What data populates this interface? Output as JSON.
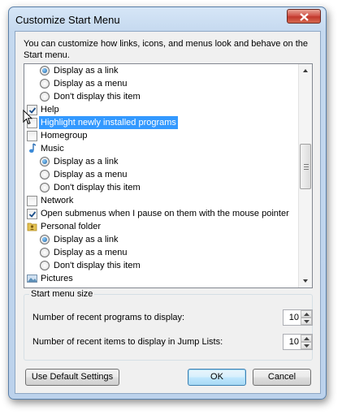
{
  "window": {
    "title": "Customize Start Menu"
  },
  "description": "You can customize how links, icons, and menus look and behave on the Start menu.",
  "list": {
    "rows": [
      {
        "kind": "radio",
        "label": "Display as a link",
        "selected": true
      },
      {
        "kind": "radio",
        "label": "Display as a menu",
        "selected": false
      },
      {
        "kind": "radio",
        "label": "Don't display this item",
        "selected": false
      },
      {
        "kind": "checkbox",
        "label": "Help",
        "checked": true
      },
      {
        "kind": "checkbox",
        "label": "Highlight newly installed programs",
        "checked": false,
        "highlighted": true
      },
      {
        "kind": "checkbox",
        "label": "Homegroup",
        "checked": false
      },
      {
        "kind": "header",
        "label": "Music",
        "icon": "music-note-icon"
      },
      {
        "kind": "radio",
        "label": "Display as a link",
        "selected": true
      },
      {
        "kind": "radio",
        "label": "Display as a menu",
        "selected": false
      },
      {
        "kind": "radio",
        "label": "Don't display this item",
        "selected": false
      },
      {
        "kind": "checkbox",
        "label": "Network",
        "checked": false
      },
      {
        "kind": "checkbox",
        "label": "Open submenus when I pause on them with the mouse pointer",
        "checked": true
      },
      {
        "kind": "header",
        "label": "Personal folder",
        "icon": "personal-folder-icon"
      },
      {
        "kind": "radio",
        "label": "Display as a link",
        "selected": true
      },
      {
        "kind": "radio",
        "label": "Display as a menu",
        "selected": false
      },
      {
        "kind": "radio",
        "label": "Don't display this item",
        "selected": false
      },
      {
        "kind": "header",
        "label": "Pictures",
        "icon": "pictures-icon"
      }
    ]
  },
  "start_menu_size": {
    "title": "Start menu size",
    "recent_programs_label": "Number of recent programs to display:",
    "recent_programs_value": "10",
    "recent_items_label": "Number of recent items to display in Jump Lists:",
    "recent_items_value": "10"
  },
  "buttons": {
    "defaults": "Use Default Settings",
    "ok": "OK",
    "cancel": "Cancel"
  },
  "colors": {
    "selection": "#3399ff",
    "close_button": "#c1382c",
    "title_gradient": "#c5d9ef"
  }
}
